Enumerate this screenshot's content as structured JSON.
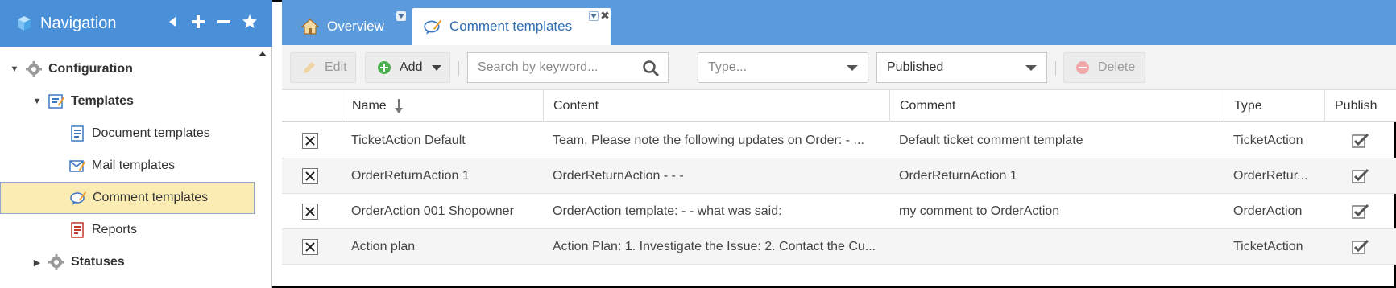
{
  "colors": {
    "header_blue": "#4a90d9",
    "tab_blue": "#5b9bdc",
    "active_tab_text": "#2f6db3",
    "selected_bg": "#fbecb4"
  },
  "nav": {
    "title": "Navigation",
    "icons": [
      "cube-icon",
      "collapse-left-icon",
      "plus-icon",
      "minus-icon",
      "star-icon"
    ],
    "tree": [
      {
        "label": "Configuration",
        "level": 0,
        "expanded": true,
        "icon": "gear-icon"
      },
      {
        "label": "Templates",
        "level": 1,
        "expanded": true,
        "icon": "template-icon"
      },
      {
        "label": "Document templates",
        "level": 2,
        "icon": "document-icon"
      },
      {
        "label": "Mail templates",
        "level": 2,
        "icon": "mail-icon"
      },
      {
        "label": "Comment templates",
        "level": 2,
        "icon": "comment-icon",
        "selected": true
      },
      {
        "label": "Reports",
        "level": 2,
        "icon": "report-icon"
      },
      {
        "label": "Statuses",
        "level": 0,
        "expanded": false,
        "icon": "gear-icon"
      }
    ]
  },
  "tabs": [
    {
      "label": "Overview",
      "icon": "home-icon",
      "active": false
    },
    {
      "label": "Comment templates",
      "icon": "comment-icon",
      "active": true
    }
  ],
  "toolbar": {
    "edit_label": "Edit",
    "add_label": "Add",
    "search_placeholder": "Search by keyword...",
    "type_placeholder": "Type...",
    "status_value": "Published",
    "delete_label": "Delete"
  },
  "table": {
    "columns": [
      "Name",
      "Content",
      "Comment",
      "Type",
      "Publish"
    ],
    "sort_column": "Name",
    "rows": [
      {
        "name": "TicketAction Default",
        "content": "Team, Please note the following updates on Order: - ...",
        "comment": "Default ticket comment template",
        "type": "TicketAction",
        "publish": true
      },
      {
        "name": "OrderReturnAction 1",
        "content": "OrderReturnAction - - -",
        "comment": "OrderReturnAction 1",
        "type": "OrderRetur...",
        "publish": true
      },
      {
        "name": "OrderAction 001 Shopowner",
        "content": "OrderAction template: - - what was said:",
        "comment": "my comment to OrderAction",
        "type": "OrderAction",
        "publish": true
      },
      {
        "name": "Action plan",
        "content": "Action Plan: 1. Investigate the Issue: 2. Contact the Cu...",
        "comment": "",
        "type": "TicketAction",
        "publish": true
      }
    ]
  }
}
